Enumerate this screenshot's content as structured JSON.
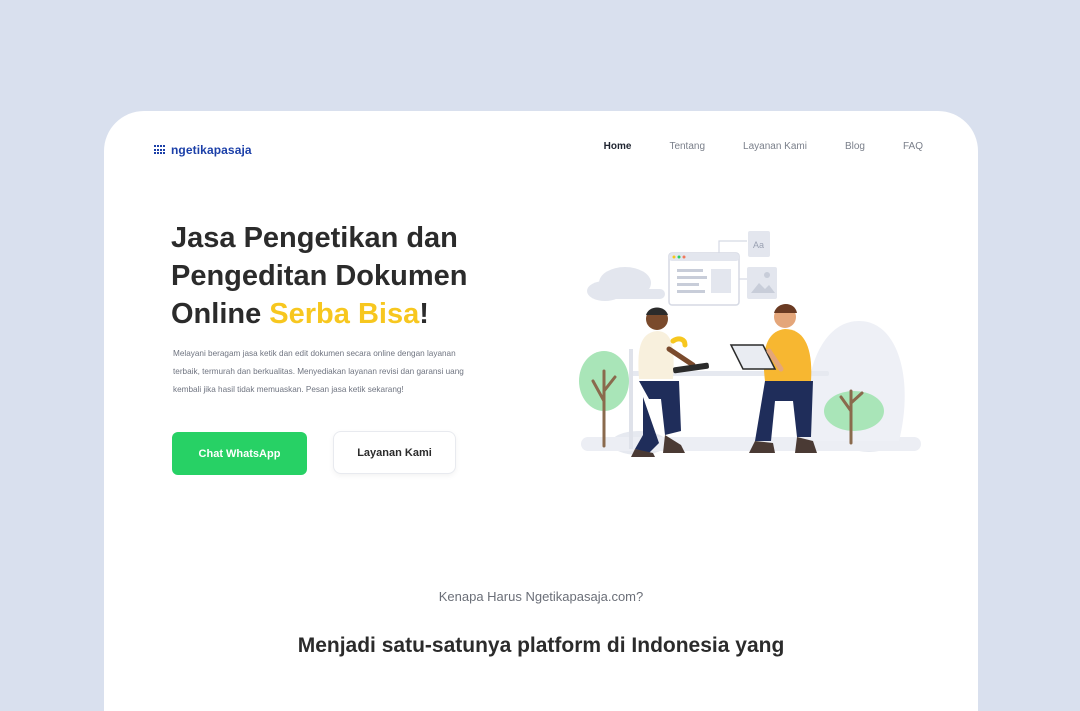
{
  "logo": {
    "text": "ngetikapasaja"
  },
  "nav": {
    "items": [
      {
        "label": "Home",
        "active": true
      },
      {
        "label": "Tentang",
        "active": false
      },
      {
        "label": "Layanan Kami",
        "active": false
      },
      {
        "label": "Blog",
        "active": false
      },
      {
        "label": "FAQ",
        "active": false
      }
    ]
  },
  "hero": {
    "title_line1": "Jasa Pengetikan dan",
    "title_line2": "Pengeditan Dokumen",
    "title_line3_prefix": "Online ",
    "title_accent": "Serba Bisa",
    "title_suffix": "!",
    "description": "Melayani beragam jasa ketik dan edit dokumen secara online dengan layanan terbaik, termurah dan berkualitas. Menyediakan layanan revisi dan garansi uang kembali jika hasil tidak memuaskan. Pesan jasa ketik sekarang!",
    "primary_button": "Chat WhatsApp",
    "secondary_button": "Layanan Kami",
    "illustration_doc_label": "Aa"
  },
  "why": {
    "label": "Kenapa Harus Ngetikapasaja.com?",
    "headline": "Menjadi satu-satunya platform di Indonesia yang"
  },
  "colors": {
    "background": "#d9e0ee",
    "brand_blue": "#1b3fa8",
    "accent_yellow": "#f7c71f",
    "whatsapp_green": "#27d165",
    "text_dark": "#2b2b2b"
  }
}
